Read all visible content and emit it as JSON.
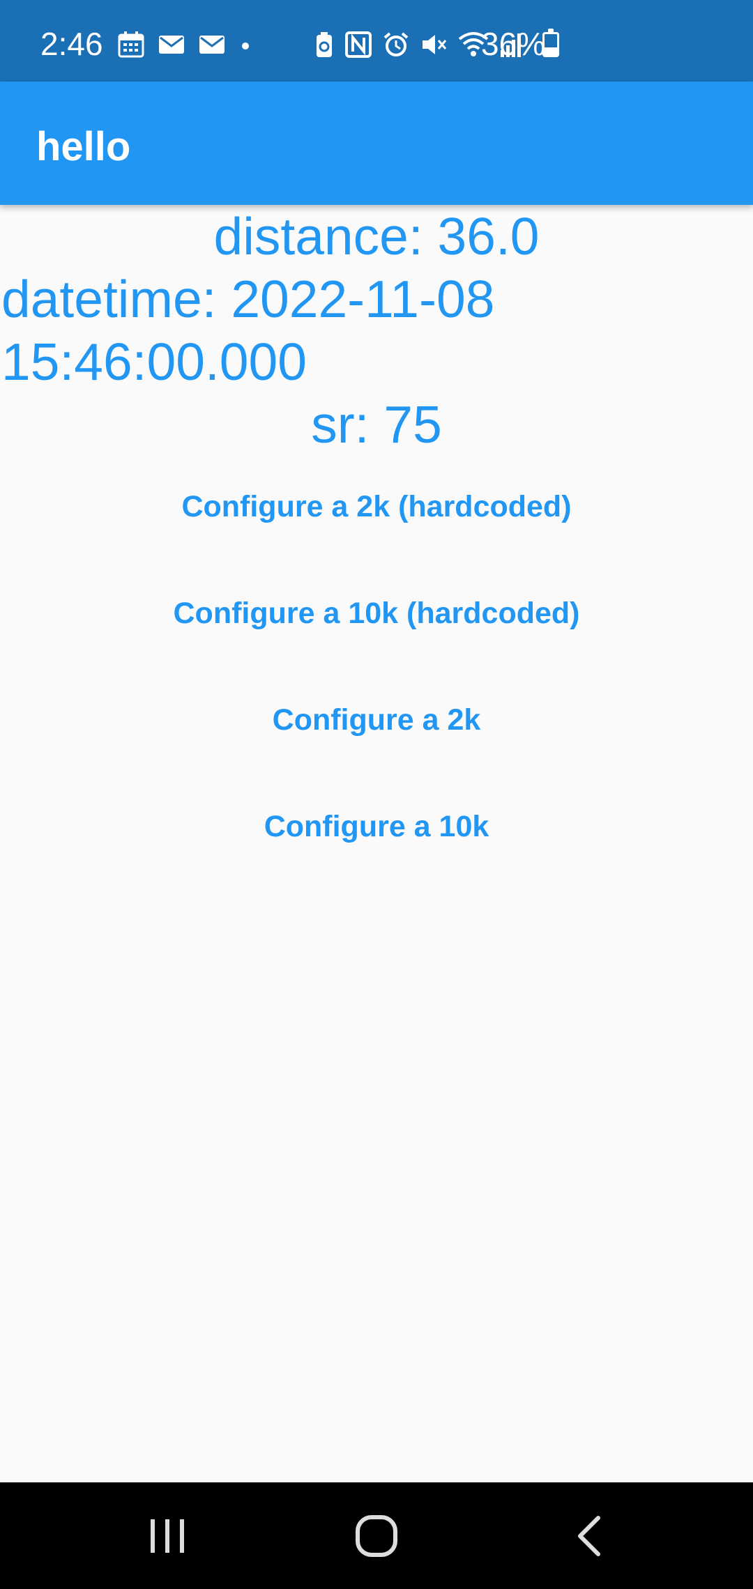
{
  "status_bar": {
    "time": "2:46",
    "battery_percent": "36%",
    "battery_level": 0.36,
    "left_icons": [
      "calendar-icon",
      "mail-icon",
      "mail-icon",
      "dot-icon"
    ],
    "right_icons": [
      "battery-saver-icon",
      "nfc-icon",
      "alarm-icon",
      "mute-icon",
      "wifi-icon",
      "signal-icon"
    ]
  },
  "app_bar": {
    "title": "hello"
  },
  "info": {
    "distance": "distance: 36.0",
    "datetime": "datetime: 2022-11-08 15:46:00.000",
    "sr": "sr: 75"
  },
  "buttons": [
    {
      "label": "Configure a 2k (hardcoded)"
    },
    {
      "label": "Configure a 10k (hardcoded)"
    },
    {
      "label": "Configure a 2k"
    },
    {
      "label": "Configure a 10k"
    }
  ],
  "nav_bar": {
    "items": [
      "recents-icon",
      "home-icon",
      "back-icon"
    ]
  },
  "colors": {
    "status_bar": "#1b6fb5",
    "app_bar": "#2196f3",
    "accent": "#2196f3",
    "background": "#fafafa"
  }
}
